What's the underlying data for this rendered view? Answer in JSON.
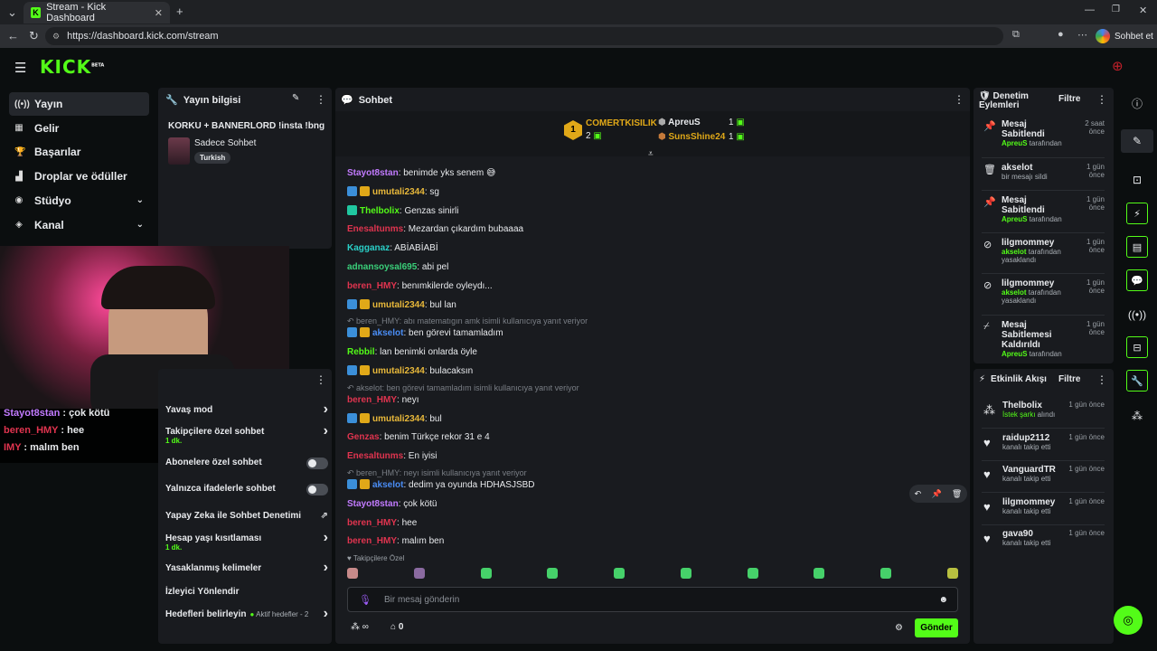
{
  "browser": {
    "tab_title": "Stream - Kick Dashboard",
    "url": "https://dashboard.kick.com/stream",
    "chat_button": "Sohbet et"
  },
  "logo": {
    "text": "KICK",
    "beta": "BETA"
  },
  "nav": [
    {
      "label": "Yayın",
      "icon": "broadcast-icon",
      "selected": true
    },
    {
      "label": "Gelir",
      "icon": "revenue-icon"
    },
    {
      "label": "Başarılar",
      "icon": "trophy-icon"
    },
    {
      "label": "Droplar ve ödüller",
      "icon": "drops-icon"
    },
    {
      "label": "Stüdyo",
      "icon": "studio-icon",
      "chevron": true
    },
    {
      "label": "Kanal",
      "icon": "channel-icon",
      "chevron": true
    }
  ],
  "stream_info": {
    "title": "Yayın bilgisi",
    "stream_title": "KORKU + BANNERLORD !insta !bng",
    "category": "Sadece Sohbet",
    "tag": "Turkish"
  },
  "webcam_overlay": {
    "lines": [
      {
        "user": "Stayot8stan",
        "text": " : çok kötü"
      },
      {
        "user": "beren_HMY",
        "text": " : hee"
      },
      {
        "user": "IMY",
        "text": " : malım ben"
      }
    ]
  },
  "chat_settings": {
    "items": [
      {
        "label": "Yavaş mod",
        "type": "chevron"
      },
      {
        "label": "Takipçilere özel sohbet",
        "sub": "1 dk.",
        "type": "chevron"
      },
      {
        "label": "Abonelere özel sohbet",
        "type": "toggle"
      },
      {
        "label": "Yalnızca ifadelerle sohbet",
        "type": "toggle"
      },
      {
        "label": "Yapay Zeka ile Sohbet Denetimi",
        "type": "external"
      },
      {
        "label": "Hesap yaşı kısıtlaması",
        "sub": "1 dk.",
        "type": "chevron"
      },
      {
        "label": "Yasaklanmış kelimeler",
        "type": "chevron"
      },
      {
        "label": "İzleyici Yönlendir",
        "type": "none"
      },
      {
        "label": "Hedefleri belirleyin",
        "sub_inline": "Aktif hedefler - 2",
        "type": "chevron"
      }
    ]
  },
  "chat": {
    "title": "Sohbet",
    "leaderboard": {
      "first_user": "COMERTKISILIK",
      "first_count": "2",
      "first_rank": "1",
      "second": {
        "user": "ApreuS",
        "count": "1"
      },
      "third": {
        "user": "SunsShine24",
        "count": "1"
      }
    },
    "messages": [
      {
        "user": "Stayot8stan",
        "color": "#c27bff",
        "text": ": benimde yks senem 😅",
        "badges": ""
      },
      {
        "user": "umutali2344",
        "color": "#e8b83a",
        "text": ": sg",
        "badges": "by"
      },
      {
        "user": "Thelbolix",
        "color": "#53fc18",
        "text": ": Genzas sinirli",
        "badges": "g"
      },
      {
        "user": "Enesaltunms",
        "color": "#e0344f",
        "text": ": Mezardan çıkardım bubaaaa",
        "badges": ""
      },
      {
        "user": "Kagganaz",
        "color": "#2ad0c8",
        "text": ": ABİABİABİ",
        "badges": ""
      },
      {
        "user": "adnansoysal695",
        "color": "#3ad07a",
        "text": ": abi pel",
        "badges": ""
      },
      {
        "user": "beren_HMY",
        "color": "#e0344f",
        "text": ": benımkilerde oyleydı...",
        "badges": ""
      },
      {
        "user": "umutali2344",
        "color": "#e8b83a",
        "text": ": bul lan",
        "badges": "by"
      },
      {
        "reply": "beren_HMY: abı matematıgın amk isimli kullanıcıya yanıt veriyor"
      },
      {
        "user": "akselot",
        "color": "#4a8df5",
        "text": ": ben görevi tamamladım",
        "badges": "by"
      },
      {
        "user": "Rebbil",
        "color": "#53fc18",
        "text": ": lan benimki onlarda öyle",
        "badges": ""
      },
      {
        "user": "umutali2344",
        "color": "#e8b83a",
        "text": ": bulacaksın",
        "badges": "by"
      },
      {
        "reply": "akselot: ben görevi tamamladım isimli kullanıcıya yanıt veriyor"
      },
      {
        "user": "beren_HMY",
        "color": "#e0344f",
        "text": ": neyı",
        "badges": ""
      },
      {
        "user": "umutali2344",
        "color": "#e8b83a",
        "text": ": bul",
        "badges": "by"
      },
      {
        "user": "Genzas",
        "color": "#e0344f",
        "text": ": benim Türkçe rekor 31 e 4",
        "badges": ""
      },
      {
        "user": "Enesaltunms",
        "color": "#e0344f",
        "text": ": En iyisi",
        "badges": ""
      },
      {
        "reply": "beren_HMY: neyı isimli kullanıcıya yanıt veriyor"
      },
      {
        "user": "akselot",
        "color": "#4a8df5",
        "text": ": dedim ya oyunda HDHASJSBD",
        "badges": "by"
      },
      {
        "user": "Stayot8stan",
        "color": "#c27bff",
        "text": ": çok kötü",
        "badges": ""
      },
      {
        "user": "beren_HMY",
        "color": "#e0344f",
        "text": ": hee",
        "badges": ""
      },
      {
        "user": "beren_HMY",
        "color": "#e0344f",
        "text": ": malım ben",
        "badges": ""
      }
    ],
    "followers_label": "Takipçilere Özel",
    "input_placeholder": "Bir mesaj gönderin",
    "points": "0",
    "send": "Gönder"
  },
  "mod_actions": {
    "title": "Denetim Eylemleri",
    "filter": "Filtre",
    "items": [
      {
        "icon": "pin-icon",
        "title": "Mesaj Sabitlendi",
        "actor": "ApreuS",
        "suffix": " tarafından",
        "time": "2 saat önce"
      },
      {
        "icon": "trash-icon",
        "title": "akselot",
        "actor": "",
        "suffix": "bir mesajı sildi",
        "time": "1 gün önce"
      },
      {
        "icon": "pin-icon",
        "title": "Mesaj Sabitlendi",
        "actor": "ApreuS",
        "suffix": " tarafından",
        "time": "1 gün önce"
      },
      {
        "icon": "ban-icon",
        "title": "lilgmommey",
        "actor": "akselot",
        "suffix": " tarafından yasaklandı",
        "time": "1 gün önce"
      },
      {
        "icon": "ban-icon",
        "title": "lilgmommey",
        "actor": "akselot",
        "suffix": " tarafından yasaklandı",
        "time": "1 gün önce"
      },
      {
        "icon": "unpin-icon",
        "title": "Mesaj Sabitlemesi Kaldırıldı",
        "actor": "ApreuS",
        "suffix": " tarafından",
        "time": "1 gün önce"
      }
    ]
  },
  "activity": {
    "title": "Etkinlik Akışı",
    "filter": "Filtre",
    "items": [
      {
        "icon": "song-icon",
        "user": "Thelbolix",
        "accent": "İstek şarkı",
        "suffix": " alındı",
        "time": "1 gün önce"
      },
      {
        "icon": "heart-icon",
        "user": "raidup2112",
        "accent": "",
        "suffix": "kanalı takip etti",
        "time": "1 gün önce"
      },
      {
        "icon": "heart-icon",
        "user": "VanguardTR",
        "accent": "",
        "suffix": "kanalı takip etti",
        "time": "1 gün önce"
      },
      {
        "icon": "heart-icon",
        "user": "lilgmommey",
        "accent": "",
        "suffix": "kanalı takip etti",
        "time": "1 gün önce"
      },
      {
        "icon": "heart-icon",
        "user": "gava90",
        "accent": "",
        "suffix": "kanalı takip etti",
        "time": "1 gün önce"
      }
    ]
  },
  "colors": {
    "accent": "#53fc18",
    "bg": "#0b0e0f",
    "panel": "#191b1f"
  }
}
